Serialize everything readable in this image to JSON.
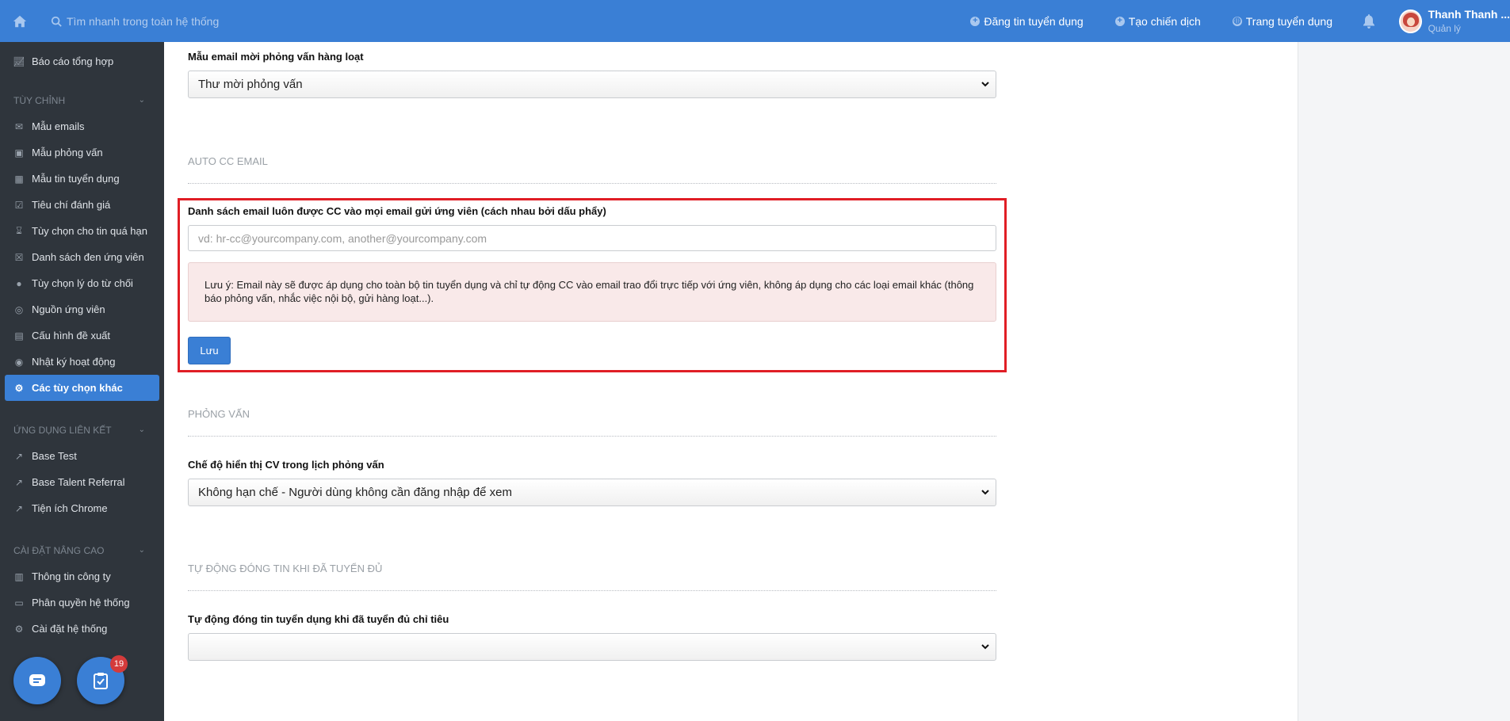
{
  "topbar": {
    "search_placeholder": "Tìm nhanh trong toàn hệ thống",
    "links": [
      {
        "label": "Đăng tin tuyển dụng"
      },
      {
        "label": "Tạo chiến dịch"
      },
      {
        "label": "Trang tuyển dụng"
      }
    ],
    "user_name": "Thanh Thanh ...",
    "user_role": "Quản lý"
  },
  "sidebar": {
    "top_item": "Báo cáo tổng hợp",
    "section_custom": "Tùy chỉnh",
    "custom_items": [
      "Mẫu emails",
      "Mẫu phỏng vấn",
      "Mẫu tin tuyển dụng",
      "Tiêu chí đánh giá",
      "Tùy chọn cho tin quá hạn",
      "Danh sách đen ứng viên",
      "Tùy chọn lý do từ chối",
      "Nguồn ứng viên",
      "Cấu hình đề xuất",
      "Nhật ký hoạt động",
      "Các tùy chọn khác"
    ],
    "section_apps": "Ứng dụng liên kết",
    "app_items": [
      "Base Test",
      "Base Talent Referral",
      "Tiện ích Chrome"
    ],
    "section_advanced": "Cài đặt nâng cao",
    "advanced_items": [
      "Thông tin công ty",
      "Phân quyền hệ thống",
      "Cài đặt hệ thống"
    ],
    "badge_count": "19"
  },
  "main": {
    "bulk_email_label": "Mẫu email mời phỏng vấn hàng loạt",
    "bulk_email_value": "Thư mời phỏng vấn",
    "auto_cc_title": "Auto CC Email",
    "cc_label": "Danh sách email luôn được CC vào mọi email gửi ứng viên (cách nhau bởi dấu phẩy)",
    "cc_placeholder": "vd: hr-cc@yourcompany.com, another@yourcompany.com",
    "cc_note": "Lưu ý: Email này sẽ được áp dụng cho toàn bộ tin tuyển dụng và chỉ tự động CC vào email trao đổi trực tiếp với ứng viên, không áp dụng cho các loại email khác (thông báo phỏng vấn, nhắc việc nội bộ, gửi hàng loạt...).",
    "save_label": "Lưu",
    "interview_title": "Phỏng vấn",
    "cv_mode_label": "Chế độ hiển thị CV trong lịch phỏng vấn",
    "cv_mode_value": "Không hạn chế - Người dùng không cần đăng nhập để xem",
    "autoclose_title": "Tự động đóng tin khi đã tuyển đủ",
    "autoclose_label": "Tự động đóng tin tuyển dụng khi đã tuyển đủ chỉ tiêu",
    "autoclose_value": ""
  }
}
